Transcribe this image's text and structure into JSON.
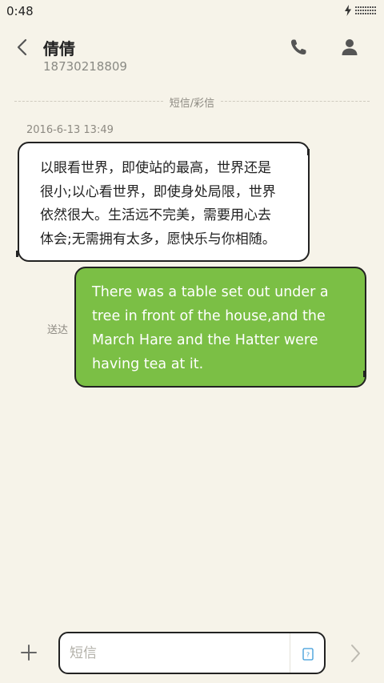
{
  "status_bar": {
    "time": "0:48",
    "icons": [
      "charging-bolt-icon",
      "battery-icon"
    ]
  },
  "header": {
    "contact_name": "倩倩",
    "phone_number": "18730218809",
    "icons": [
      "back-arrow-icon",
      "phone-icon",
      "contact-person-icon"
    ]
  },
  "conversation": {
    "divider_label": "短信/彩信",
    "timestamp": "2016-6-13 13:49",
    "incoming_lines": [
      "以眼看世界，即使站的最高，世界还是",
      "很小;以心看世界，即使身处局限，世界",
      "依然很大。生活远不完美，需要用心去",
      "体会;无需拥有太多，愿快乐与你相随。"
    ],
    "sent_status": "送达",
    "outgoing_lines": [
      "There was a table set out under a",
      "tree in front of the house,and the",
      "March Hare and the Hatter were",
      "having tea at it."
    ]
  },
  "composer": {
    "placeholder": "短信",
    "value": "",
    "icons": [
      "plus-icon",
      "quick-template-icon",
      "send-arrow-icon"
    ]
  },
  "colors": {
    "background": "#f6f3e9",
    "outgoing_bubble": "#7bbf45",
    "incoming_bubble": "#ffffff",
    "bubble_border": "#222222",
    "muted_text": "#8d8a82",
    "accent_icon": "#3a9ad9"
  }
}
